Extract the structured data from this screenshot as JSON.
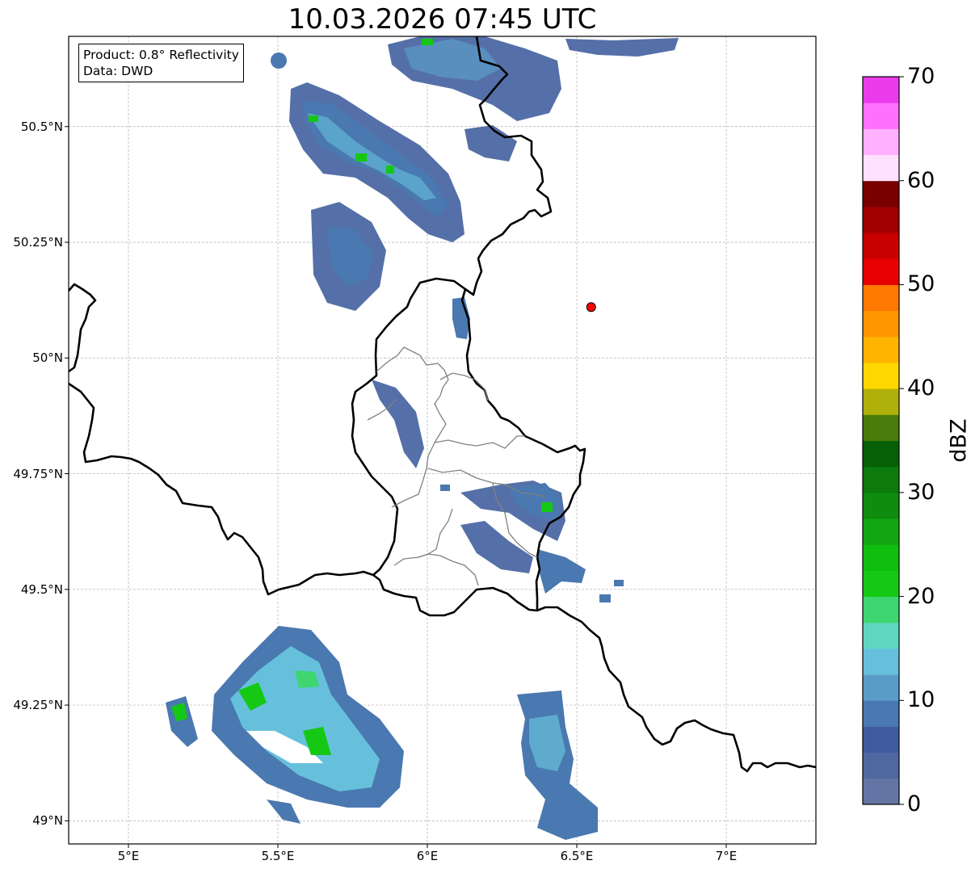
{
  "title": "10.03.2026 07:45 UTC",
  "info": {
    "product": "Product: 0.8° Reflectivity",
    "data": "Data: DWD"
  },
  "map": {
    "lon_range": [
      4.8,
      7.3
    ],
    "lat_range": [
      48.95,
      50.695
    ],
    "x_ticks": [
      {
        "lon": 5.0,
        "label": "5°E"
      },
      {
        "lon": 5.5,
        "label": "5.5°E"
      },
      {
        "lon": 6.0,
        "label": "6°E"
      },
      {
        "lon": 6.5,
        "label": "6.5°E"
      },
      {
        "lon": 7.0,
        "label": "7°E"
      }
    ],
    "y_ticks": [
      {
        "lat": 50.5,
        "label": "50.5°N"
      },
      {
        "lat": 50.25,
        "label": "50.25°N"
      },
      {
        "lat": 50.0,
        "label": "50°N"
      },
      {
        "lat": 49.75,
        "label": "49.75°N"
      },
      {
        "lat": 49.5,
        "label": "49.5°N"
      },
      {
        "lat": 49.25,
        "label": "49.25°N"
      },
      {
        "lat": 49.0,
        "label": "49°N"
      }
    ],
    "grid": true,
    "radar_site": {
      "lon": 6.548,
      "lat": 50.11,
      "color": "#ff0000"
    },
    "border_color": "#000000",
    "district_color": "#808080"
  },
  "colorbar": {
    "label": "dBZ",
    "min": 0,
    "max": 70,
    "step": 2.5,
    "ticks": [
      "0",
      "10",
      "20",
      "30",
      "40",
      "50",
      "60",
      "70"
    ],
    "colors": [
      "#6474a4",
      "#4f68a0",
      "#3f5ba0",
      "#4a78b0",
      "#5a9cc8",
      "#66c0dc",
      "#5ed6c0",
      "#3dd670",
      "#14c814",
      "#0fbe0f",
      "#12a612",
      "#0e8c0e",
      "#0c7a0c",
      "#066006",
      "#4a7a0a",
      "#b0b00a",
      "#ffd700",
      "#ffb400",
      "#ff9600",
      "#ff7800",
      "#e60000",
      "#c80000",
      "#a00000",
      "#7a0000",
      "#ffe0ff",
      "#ffb0ff",
      "#ff70ff",
      "#ea3cea"
    ]
  }
}
